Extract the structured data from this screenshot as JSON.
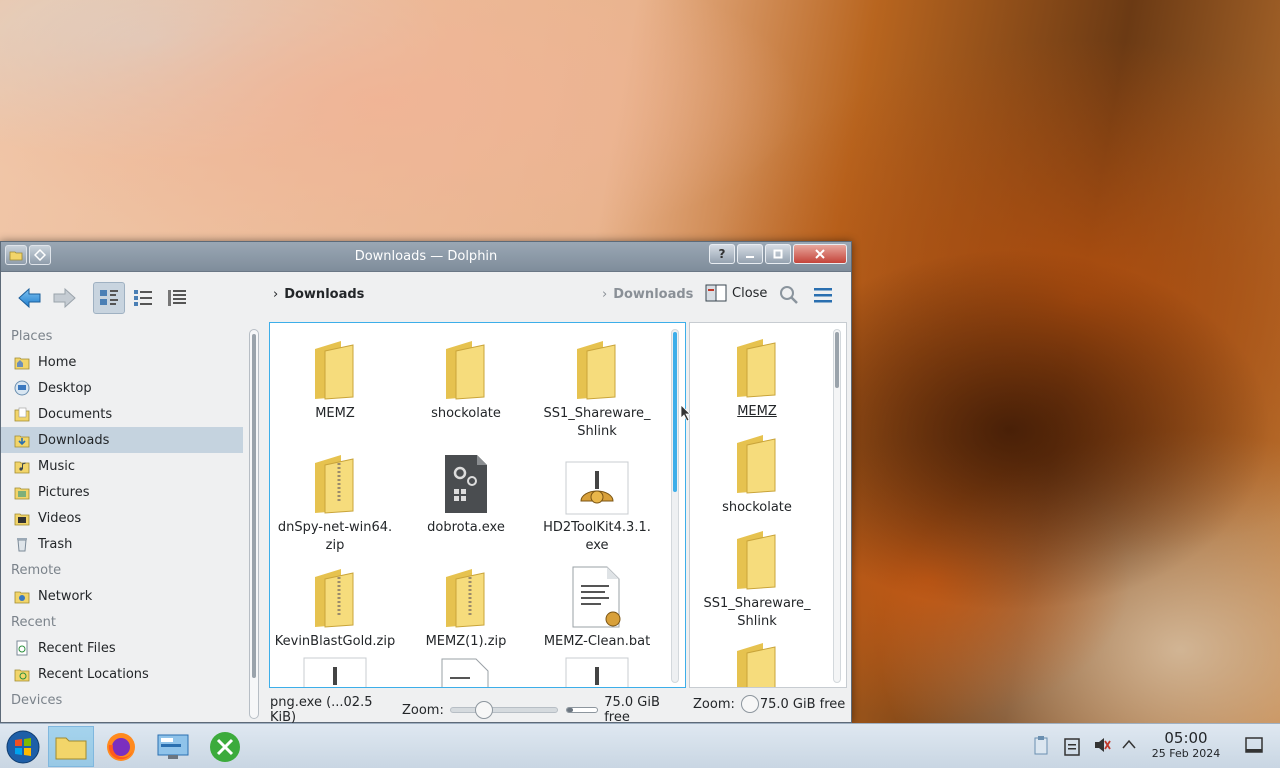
{
  "window": {
    "title": "Downloads — Dolphin",
    "help_label": "?"
  },
  "toolbar": {
    "breadcrumb_primary": "Downloads",
    "breadcrumb_secondary": "Downloads",
    "close_label": "Close"
  },
  "places": {
    "sections": {
      "places": "Places",
      "remote": "Remote",
      "recent": "Recent",
      "devices": "Devices"
    },
    "items": [
      {
        "label": "Home"
      },
      {
        "label": "Desktop"
      },
      {
        "label": "Documents"
      },
      {
        "label": "Downloads",
        "selected": true
      },
      {
        "label": "Music"
      },
      {
        "label": "Pictures"
      },
      {
        "label": "Videos"
      },
      {
        "label": "Trash"
      },
      {
        "label": "Network"
      },
      {
        "label": "Recent Files"
      },
      {
        "label": "Recent Locations"
      }
    ]
  },
  "left_pane": {
    "files": [
      {
        "name": "MEMZ",
        "icon": "folder-icon"
      },
      {
        "name": "shockolate",
        "icon": "folder-icon"
      },
      {
        "name": "SS1_Shareware_\nShlink",
        "icon": "folder-icon"
      },
      {
        "name": "dnSpy-net-win64.\nzip",
        "icon": "zip-icon"
      },
      {
        "name": "dobrota.exe",
        "icon": "exe-icon"
      },
      {
        "name": "HD2ToolKit4.3.1.\nexe",
        "icon": "installer-icon"
      },
      {
        "name": "KevinBlastGold.zip",
        "icon": "zip-icon"
      },
      {
        "name": "MEMZ(1).zip",
        "icon": "zip-icon"
      },
      {
        "name": "MEMZ-Clean.bat",
        "icon": "batch-icon"
      }
    ],
    "status_text": "png.exe (...02.5 KiB)",
    "zoom_label": "Zoom:",
    "free_space": "75.0 GiB free"
  },
  "right_pane": {
    "files": [
      {
        "name": "MEMZ",
        "icon": "folder-icon"
      },
      {
        "name": "shockolate",
        "icon": "folder-icon"
      },
      {
        "name": "SS1_Shareware_\nShlink",
        "icon": "folder-icon"
      }
    ],
    "zoom_label": "Zoom:",
    "free_space": "75.0 GiB free"
  },
  "taskbar": {
    "clock_time": "05:00",
    "clock_date": "25 Feb 2024"
  },
  "colors": {
    "accent": "#3daee9",
    "folder": "#f2d56a",
    "titlebar": "#8795a3"
  }
}
